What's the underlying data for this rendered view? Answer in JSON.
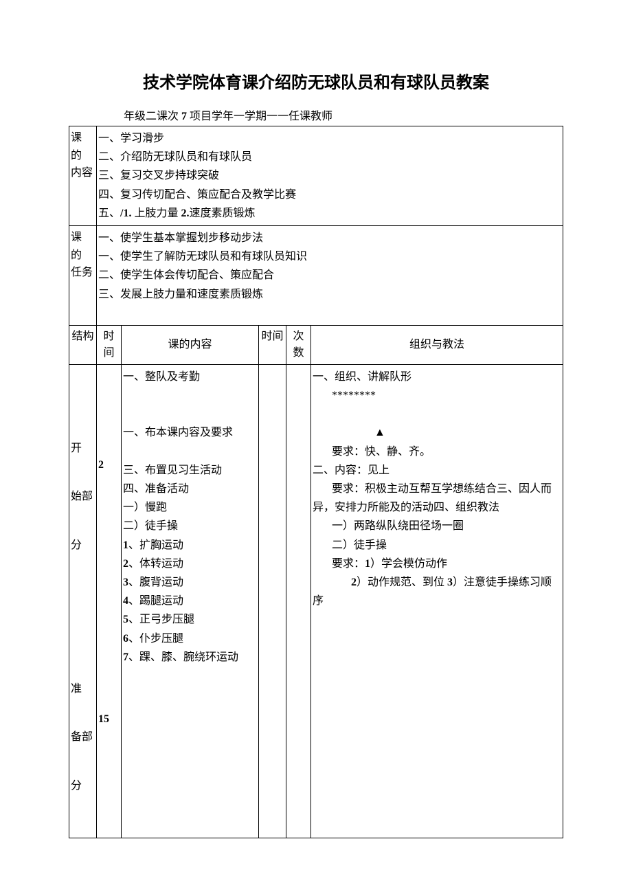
{
  "title": "技术学院体育课介绍防无球队员和有球队员教案",
  "meta": {
    "line": "年级二课次 7 项目学年一学期一一任课教师",
    "grade_prefix": "年级二课次 ",
    "lesson_no": "7",
    "meta_suffix": " 项目学年一学期一一任课教师"
  },
  "section_labels": {
    "content_label_1": "课 的",
    "content_label_2": "内容",
    "task_label_1": "课 的",
    "task_label_2": "任务"
  },
  "course_content": {
    "l1": "一、学习滑步",
    "l2": "二、介绍防无球队员和有球队员",
    "l3": "三、复习交叉步持球突破",
    "l4": "四、复习传切配合、策应配合及教学比赛",
    "l5_prefix": "五、",
    "l5_b1": "/1.",
    "l5_mid": " 上肢力量 ",
    "l5_b2": "2.",
    "l5_suffix": "速度素质锻炼"
  },
  "course_task": {
    "l1": "一、使学生基本掌握划步移动步法",
    "l2": "一、使学生了解防无球队员和有球队员知识",
    "l3": "二、使学生体会传切配合、策应配合",
    "l4": "三、发展上肢力量和速度素质锻炼"
  },
  "headers": {
    "structure": "结构",
    "time": "时间",
    "content": "课的内容",
    "time2": "时间",
    "count_l1": "次",
    "count_l2": "数",
    "method": "组织与教法"
  },
  "body": {
    "structure": {
      "s1_l1": "开",
      "s1_l2": "始部",
      "s1_l3": "分",
      "s2_l1": "准",
      "s2_l2": "备部",
      "s2_l3": "分"
    },
    "time": {
      "t1": "2",
      "t2": "15"
    },
    "content": {
      "c1": "一、整队及考勤",
      "c2": "一、布本课内容及要求",
      "c3": "三、布置见习生活动",
      "c4": "四、准备活动",
      "c5": "一）慢跑",
      "c6": "二）徒手操",
      "c7p": "1",
      "c7s": "、扩胸运动",
      "c8p": "2",
      "c8s": "、体转运动",
      "c9p": "3",
      "c9s": "、腹背运动",
      "c10p": "4",
      "c10s": "、踢腿运动",
      "c11p": "5",
      "c11s": "、正弓步压腿",
      "c12p": "6",
      "c12s": "、仆步压腿",
      "c13p": "7",
      "c13s": "、踝、膝、腕绕环运动"
    },
    "method": {
      "m1": "一、组织、讲解队形",
      "m2": "********",
      "m3": "▲",
      "m4": "要求：快、静、齐。",
      "m5": "二、内容：见上",
      "m6": "要求：积极主动互帮互学想练结合三、因人而",
      "m6b": "异，安排力所能及的活动四、组织教法",
      "m7": "一）两路纵队绕田径场一圈",
      "m8": "二）徒手操",
      "m9a": "要求：",
      "m9b": "1",
      "m9c": "）学会模仿动作",
      "m10a": "2",
      "m10b": "）动作规范、到位 ",
      "m10c": "3",
      "m10d": "）注意徒手操练习顺",
      "m11": "序"
    }
  }
}
